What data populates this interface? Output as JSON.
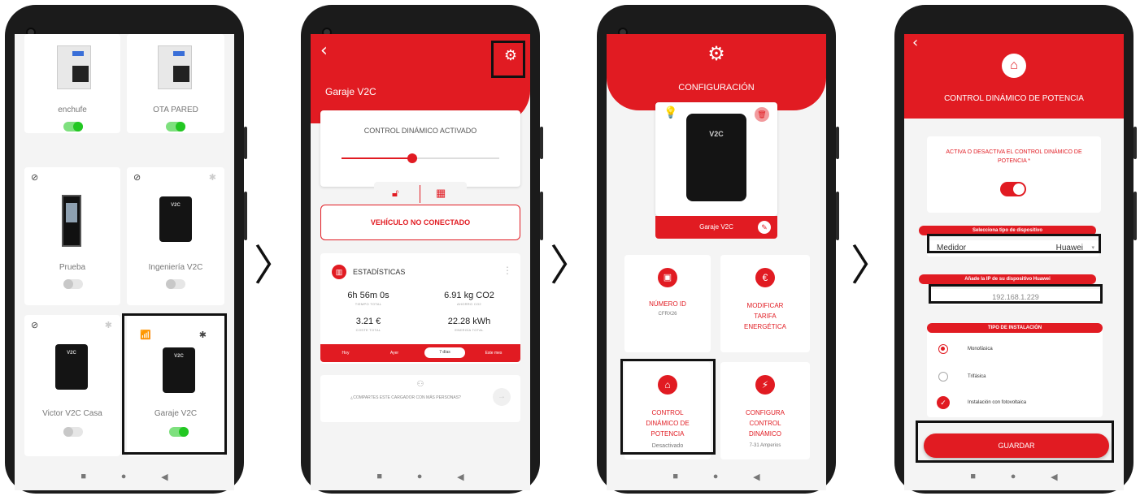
{
  "colors": {
    "accent": "#e11b22",
    "toggle_on": "#22c722"
  },
  "system_nav": {
    "home": "●",
    "back": "◀",
    "recent": "■"
  },
  "arrow_glyph": "〉",
  "screen1": {
    "devices": [
      {
        "name": "enchufe",
        "toggle": "on"
      },
      {
        "name": "OTA PARED",
        "toggle": "on"
      },
      {
        "name": "Prueba",
        "toggle": "off"
      },
      {
        "name": "Ingeniería V2C",
        "toggle": "off",
        "logo": "V2C"
      },
      {
        "name": "Victor V2C Casa",
        "toggle": "off",
        "logo": "V2C"
      },
      {
        "name": "Garaje V2C",
        "toggle": "on",
        "logo": "V2C"
      }
    ]
  },
  "screen2": {
    "title": "Garaje V2C",
    "control_card_title": "CONTROL DINÁMICO ACTIVADO",
    "slider_level_fraction": 0.45,
    "vehicle_status": "VEHÍCULO NO CONECTADO",
    "stats_title": "ESTADÍSTICAS",
    "stats": [
      {
        "value": "6h 56m 0s",
        "label": "TIEMPO TOTAL"
      },
      {
        "value": "6.91 kg CO2",
        "label": "AHORRO CO2"
      },
      {
        "value": "3.21 €",
        "label": "COSTE TOTAL"
      },
      {
        "value": "22.28 kWh",
        "label": "ENERGÍA TOTAL"
      }
    ],
    "tabs": [
      "Hoy",
      "Ayer",
      "7 días",
      "Este mes"
    ],
    "active_tab": "7 días",
    "share_text": "¿COMPARTES ESTE CARGADOR CON MÁS PERSONAS?"
  },
  "screen3": {
    "header_title": "CONFIGURACIÓN",
    "charger_logo": "V2C",
    "charger_name": "Garaje V2C",
    "tiles": [
      {
        "title": "NÚMERO ID",
        "subtitle": "CFRX26"
      },
      {
        "title": "MODIFICAR TARIFA ENERGÉTICA",
        "subtitle": ""
      },
      {
        "title": "CONTROL DINÁMICO DE POTENCIA",
        "subtitle": "Desactivado"
      },
      {
        "title": "CONFIGURA CONTROL DINÁMICO",
        "subtitle": "7-31 Amperios"
      }
    ]
  },
  "screen4": {
    "header_title": "CONTROL DINÁMICO DE POTENCIA",
    "toggle_prompt": "ACTIVA O DESACTIVA EL CONTROL DINÁMICO DE POTENCIA *",
    "device_type_label": "Selecciona tipo de dispositivo",
    "device_type_value": "Medidor",
    "device_brand_value": "Huawei",
    "ip_label": "Añade la IP de su dispositivo Huawei",
    "ip_value": "192.168.1.229",
    "install_type_label": "TIPO DE INSTALACIÓN",
    "install_options": [
      "Monofásica",
      "Trifásica",
      "Instalación con fotovoltaica"
    ],
    "save_button": "GUARDAR"
  }
}
